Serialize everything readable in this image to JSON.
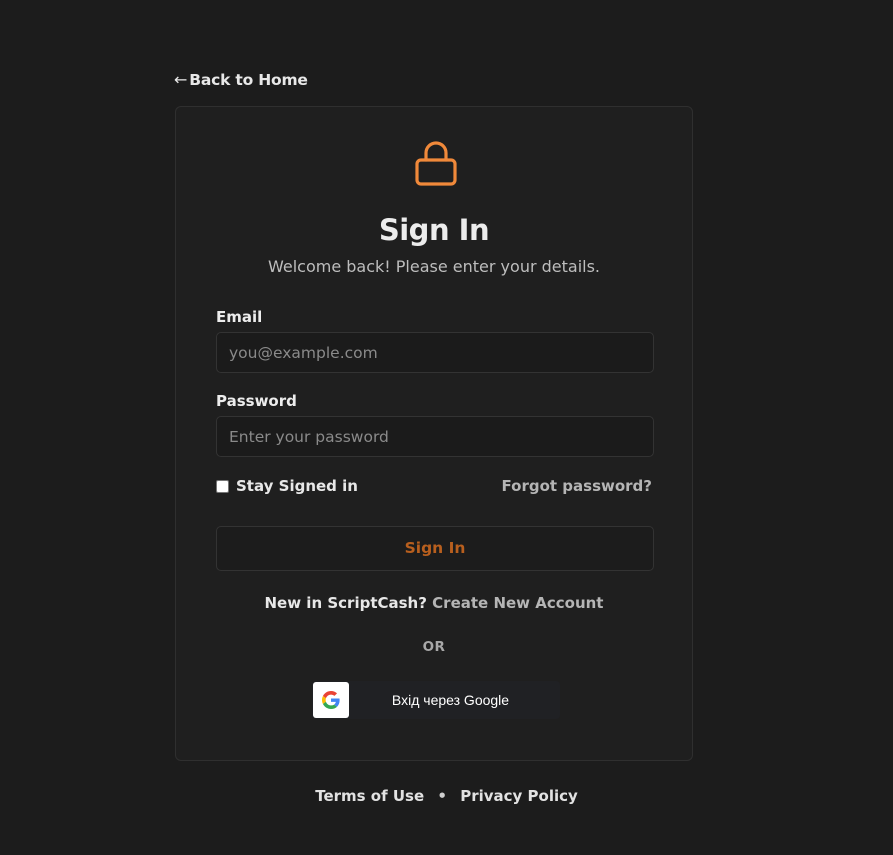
{
  "nav": {
    "back_arrow": "←",
    "back_label": "Back to Home"
  },
  "header": {
    "title": "Sign In",
    "subtitle": "Welcome back! Please enter your details."
  },
  "form": {
    "email_label": "Email",
    "email_placeholder": "you@example.com",
    "email_value": "",
    "password_label": "Password",
    "password_placeholder": "Enter your password",
    "password_value": "",
    "stay_signed_in_label": "Stay Signed in",
    "stay_signed_in_checked": false,
    "forgot_password_label": "Forgot password?",
    "submit_label": "Sign In"
  },
  "signup": {
    "prompt": "New in ScriptCash?",
    "link_label": "Create New Account"
  },
  "divider": {
    "label": "OR"
  },
  "google": {
    "label": "Вхід через Google",
    "icon": "google-g-icon"
  },
  "footer": {
    "terms_label": "Terms of Use",
    "separator": "•",
    "privacy_label": "Privacy Policy"
  },
  "colors": {
    "accent": "#f0893a",
    "button_text": "#b85f1e",
    "background": "#1c1c1c",
    "card": "#1f1f1f"
  }
}
